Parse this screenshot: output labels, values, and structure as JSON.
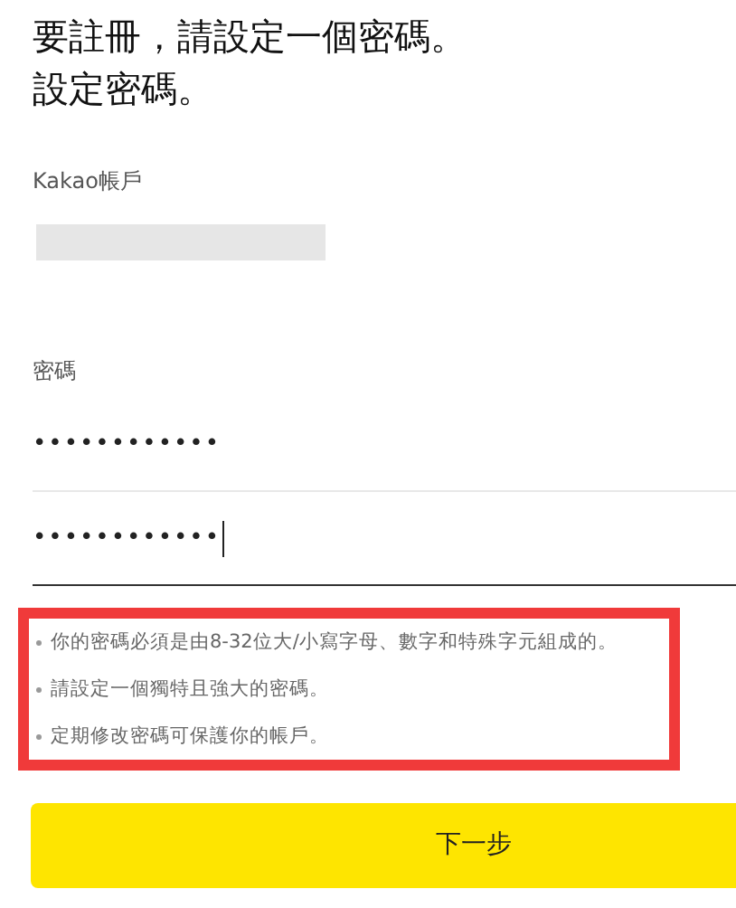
{
  "heading": [
    "要註冊，請設定一個密碼。",
    "設定密碼。"
  ],
  "account": {
    "label": "Kakao帳戶",
    "value_redacted": true
  },
  "password": {
    "label": "密碼",
    "value": "••••••••••••",
    "focused": false
  },
  "confirm_password": {
    "value": "••••••••••••",
    "focused": true
  },
  "rules": [
    "你的密碼必須是由8-32位大/小寫字母、數字和特殊字元組成的。",
    "請設定一個獨特且強大的密碼。",
    "定期修改密碼可保護你的帳戶。"
  ],
  "next_button": {
    "label": "下一步"
  }
}
